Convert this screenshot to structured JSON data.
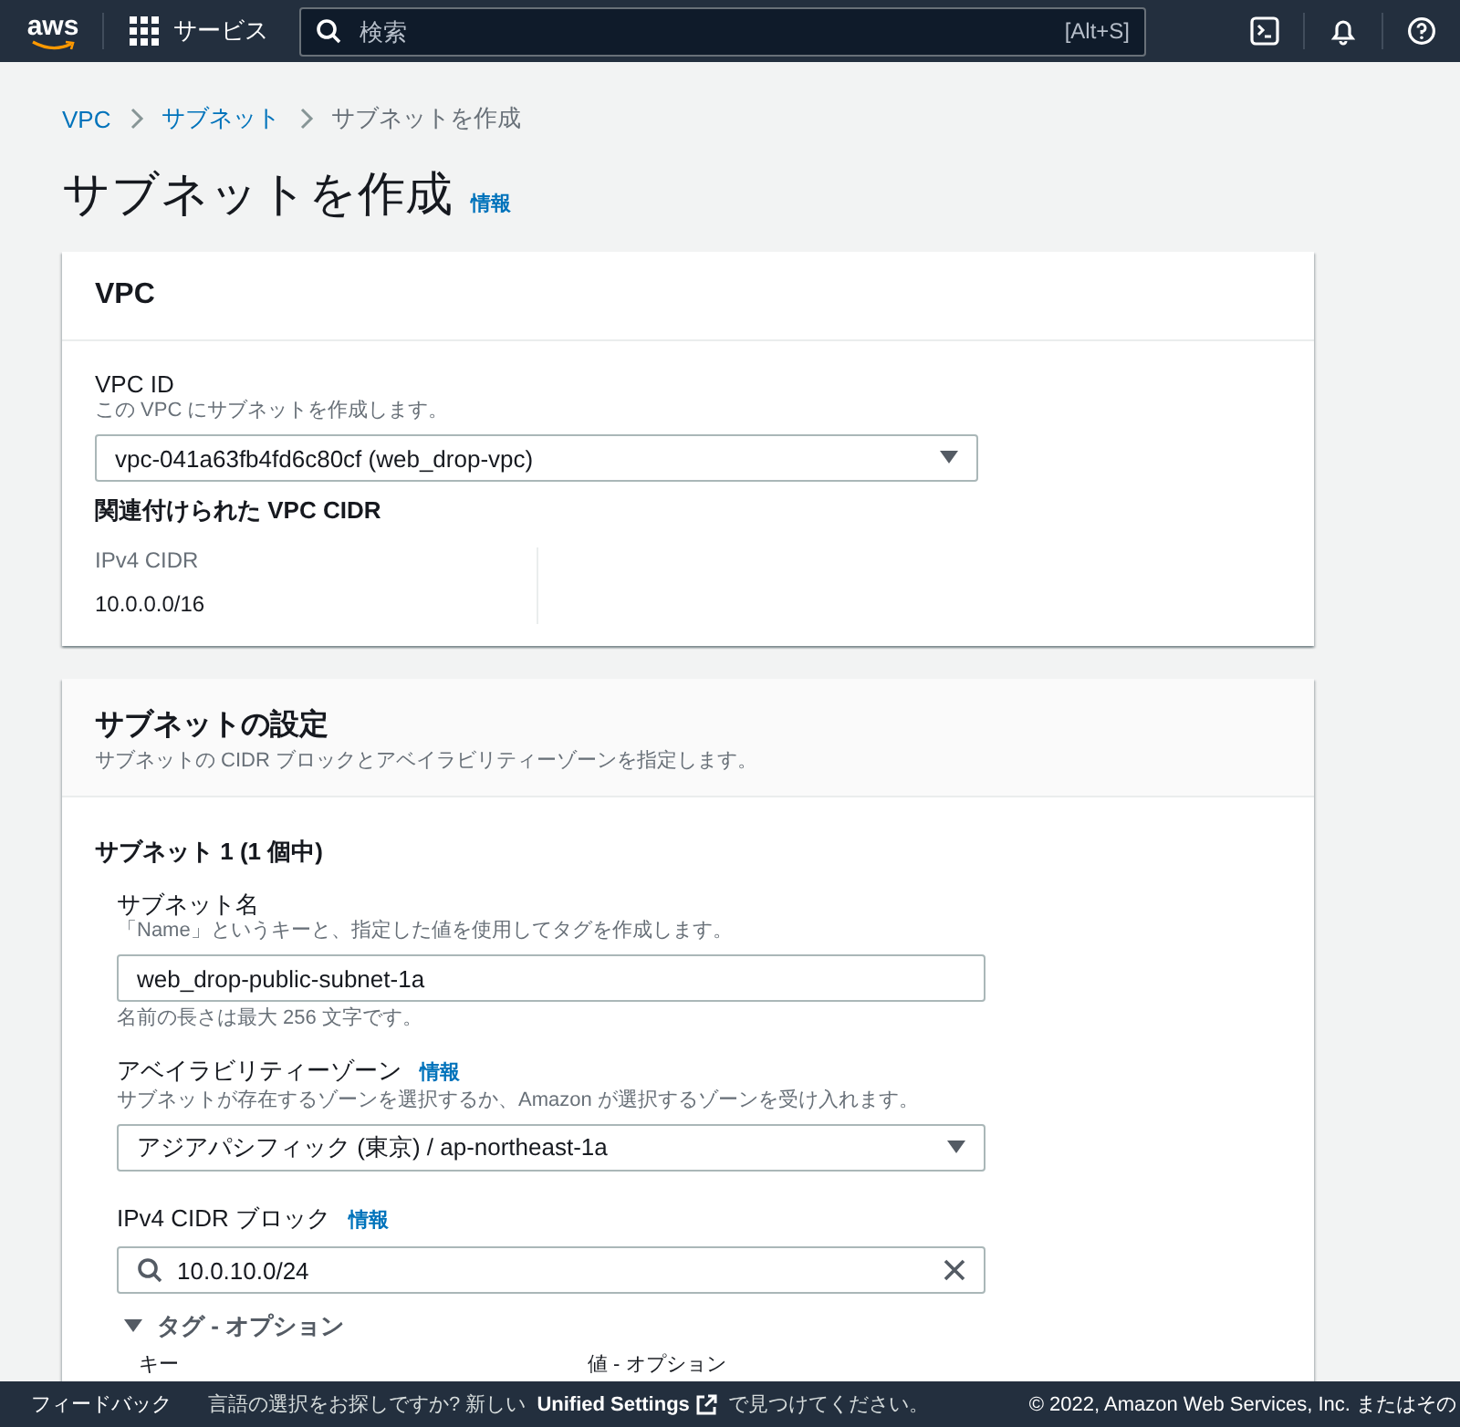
{
  "topbar": {
    "logo": "aws",
    "services": "サービス",
    "search": {
      "placeholder": "検索",
      "shortcut": "[Alt+S]"
    }
  },
  "breadcrumbs": [
    {
      "label": "VPC",
      "current": false
    },
    {
      "label": "サブネット",
      "current": false
    },
    {
      "label": "サブネットを作成",
      "current": true
    }
  ],
  "page_title": "サブネットを作成",
  "page_info": "情報",
  "vpc_panel": {
    "title": "VPC",
    "vpc_id": {
      "label": "VPC ID",
      "description": "この VPC にサブネットを作成します。",
      "value": "vpc-041a63fb4fd6c80cf (web_drop-vpc)"
    },
    "cidr_section": {
      "title": "関連付けられた VPC CIDR",
      "column_label": "IPv4 CIDR",
      "value": "10.0.0.0/16"
    }
  },
  "subnet_panel": {
    "title": "サブネットの設定",
    "description": "サブネットの CIDR ブロックとアベイラビリティーゾーンを指定します。",
    "subnet": {
      "title": "サブネット 1 (1 個中)",
      "name_field": {
        "label": "サブネット名",
        "description": "「Name」というキーと、指定した値を使用してタグを作成します。",
        "value": "web_drop-public-subnet-1a",
        "hint": "名前の長さは最大 256 文字です。"
      },
      "az_field": {
        "label": "アベイラビリティーゾーン",
        "info": "情報",
        "description": "サブネットが存在するゾーンを選択するか、Amazon が選択するゾーンを受け入れます。",
        "value": "アジアパシフィック (東京) / ap-northeast-1a"
      },
      "cidr_field": {
        "label": "IPv4 CIDR ブロック",
        "info": "情報",
        "value": "10.0.10.0/24"
      },
      "tags": {
        "title": "タグ - オプション",
        "expanded": true,
        "columns": [
          "キー",
          "値 - オプション"
        ]
      }
    }
  },
  "footer": {
    "feedback": "フィードバック",
    "message_before": "言語の選択をお探しですか? 新しい",
    "link": "Unified Settings",
    "message_after": "で見つけてください。",
    "copyright": "© 2022, Amazon Web Services, Inc. またはその"
  }
}
